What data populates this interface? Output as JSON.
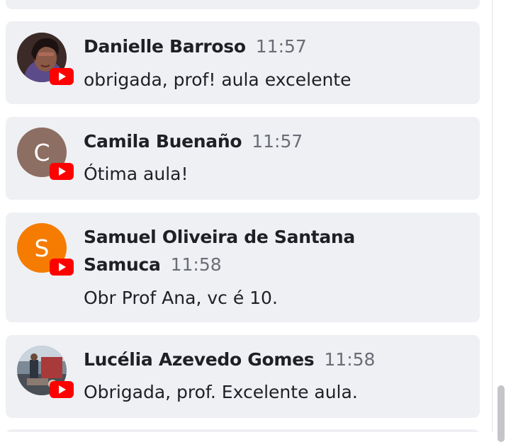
{
  "platform_icon": "youtube-icon",
  "messages": [
    {
      "author": "Danielle Barroso",
      "time": "11:57",
      "text": "obrigada, prof! aula excelente",
      "avatar": {
        "type": "photo",
        "color": "#2a1d1c"
      }
    },
    {
      "author": "Camila Buenaño",
      "time": "11:57",
      "text": "Ótima aula!",
      "avatar": {
        "type": "letter",
        "letter": "C",
        "color": "#8d6e63"
      }
    },
    {
      "author": "Samuel Oliveira de Santana Samuca",
      "author_line1": "Samuel Oliveira de Santana",
      "author_line2": "Samuca",
      "time": "11:58",
      "text": "Obr Prof Ana, vc é 10.",
      "avatar": {
        "type": "letter",
        "letter": "S",
        "color": "#f57c00"
      }
    },
    {
      "author": "Lucélia Azevedo Gomes",
      "time": "11:58",
      "text": "Obrigada, prof. Excelente aula.",
      "avatar": {
        "type": "photo",
        "color": "#5a6470"
      }
    }
  ],
  "colors": {
    "card_bg": "#eff0f4",
    "youtube_red": "#ff0000",
    "text": "#1f2025",
    "time": "#6a6d76"
  }
}
